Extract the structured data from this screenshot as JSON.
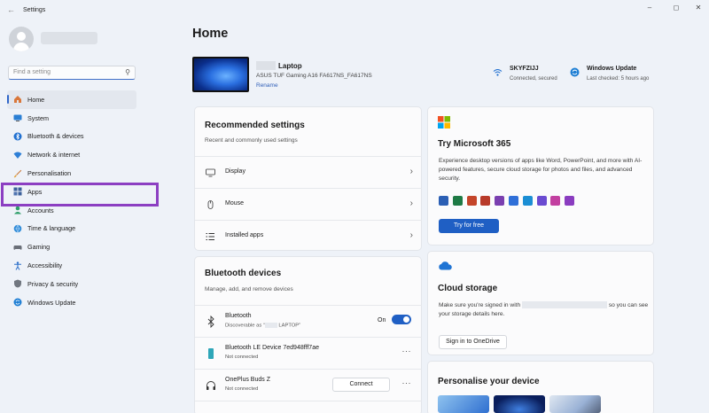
{
  "window": {
    "title": "Settings",
    "minimize": "–",
    "maximize": "◻",
    "close": "✕"
  },
  "search": {
    "placeholder": "Find a setting"
  },
  "nav": [
    {
      "label": "Home",
      "icon": "home-icon",
      "active": true
    },
    {
      "label": "System",
      "icon": "system-icon"
    },
    {
      "label": "Bluetooth & devices",
      "icon": "bluetooth-icon"
    },
    {
      "label": "Network & internet",
      "icon": "wifi-icon"
    },
    {
      "label": "Personalisation",
      "icon": "brush-icon"
    },
    {
      "label": "Apps",
      "icon": "apps-icon"
    },
    {
      "label": "Accounts",
      "icon": "accounts-icon"
    },
    {
      "label": "Time & language",
      "icon": "globe-icon"
    },
    {
      "label": "Gaming",
      "icon": "gaming-icon"
    },
    {
      "label": "Accessibility",
      "icon": "accessibility-icon"
    },
    {
      "label": "Privacy & security",
      "icon": "shield-icon"
    },
    {
      "label": "Windows Update",
      "icon": "update-icon"
    }
  ],
  "page": {
    "title": "Home"
  },
  "device": {
    "name": "Laptop",
    "model": "ASUS TUF Gaming A16 FA617NS_FA617NS",
    "rename": "Rename"
  },
  "network": {
    "name": "SKYFZIJJ",
    "status": "Connected, secured"
  },
  "update": {
    "title": "Windows Update",
    "status": "Last checked: 5 hours ago"
  },
  "recommended": {
    "title": "Recommended settings",
    "subtitle": "Recent and commonly used settings",
    "items": [
      {
        "label": "Display",
        "icon": "display-icon"
      },
      {
        "label": "Mouse",
        "icon": "mouse-icon"
      },
      {
        "label": "Installed apps",
        "icon": "installed-apps-icon"
      }
    ]
  },
  "bluetooth": {
    "title": "Bluetooth devices",
    "subtitle": "Manage, add, and remove devices",
    "toggle_label": "On",
    "discoverable_prefix": "Discoverable as “",
    "discoverable_suffix": " LAPTOP”",
    "devices": [
      {
        "name": "Bluetooth",
        "icon": "bluetooth-icon"
      },
      {
        "name": "Bluetooth LE Device 7ed948fff7ae",
        "status": "Not connected",
        "icon": "le-device-icon"
      },
      {
        "name": "OnePlus Buds Z",
        "status": "Not connected",
        "icon": "headphones-icon",
        "action": "Connect"
      }
    ]
  },
  "microsoft365": {
    "title": "Try Microsoft 365",
    "description": "Experience desktop versions of apps like Word, PowerPoint, and more with AI-powered features, secure cloud storage for photos and files, and advanced security.",
    "button": "Try for free",
    "app_colors": [
      "#2b5fb4",
      "#1e7a45",
      "#c4452a",
      "#b83a2a",
      "#7a3fb0",
      "#2f6fd8",
      "#1b8ed4",
      "#6a4bd1",
      "#c23fa0",
      "#8a3cc0"
    ]
  },
  "cloud": {
    "title": "Cloud storage",
    "description_start": "Make sure you're signed in with",
    "description_end": "so you can see your storage details here.",
    "button": "Sign in to OneDrive"
  },
  "personalise": {
    "title": "Personalise your device"
  },
  "colors": {
    "accent": "#1f5fc4",
    "highlight": "#8c3fc2"
  }
}
